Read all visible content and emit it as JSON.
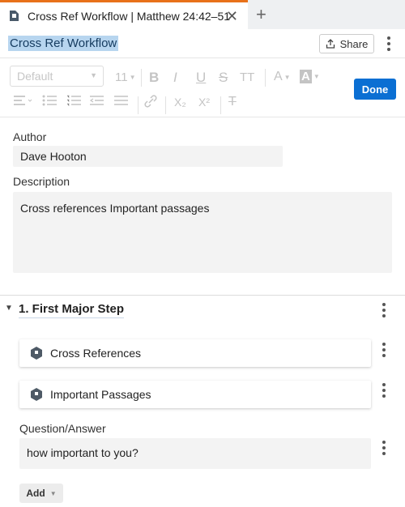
{
  "tab": {
    "title": "Cross Ref Workflow | Matthew 24:42–51",
    "close_glyph": "✕",
    "add_glyph": "+"
  },
  "header": {
    "doc_title": "Cross Ref Workflow",
    "share_label": "Share"
  },
  "toolbar": {
    "style_value": "Default",
    "font_size": "11",
    "done_label": "Done",
    "glyphs": {
      "bold": "B",
      "italic": "I",
      "underline": "U",
      "strike": "S",
      "text_size": "TT",
      "font_color": "A",
      "highlight": "A",
      "subscript": "X₂",
      "superscript": "X²",
      "clear": "T"
    }
  },
  "form": {
    "author_label": "Author",
    "author_value": "Dave Hooton",
    "description_label": "Description",
    "description_value": "Cross references Important passages"
  },
  "step": {
    "title": "1. First Major Step",
    "items": [
      {
        "label": "Cross References"
      },
      {
        "label": "Important Passages"
      }
    ],
    "qa_label": "Question/Answer",
    "qa_value": "how important to you?",
    "add_label": "Add"
  },
  "colors": {
    "accent_tab": "#e8711a",
    "done_button": "#0b6fd3",
    "title_highlight": "#b7d5ef"
  }
}
